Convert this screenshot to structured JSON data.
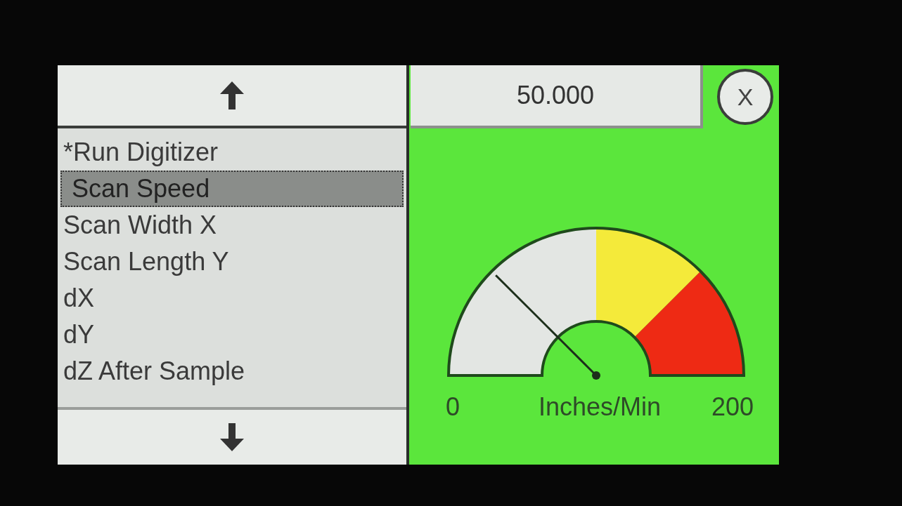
{
  "menu": {
    "items": [
      {
        "label": "*Run Digitizer",
        "selected": false
      },
      {
        "label": "Scan Speed",
        "selected": true
      },
      {
        "label": "Scan Width X",
        "selected": false
      },
      {
        "label": "Scan Length Y",
        "selected": false
      },
      {
        "label": "dX",
        "selected": false
      },
      {
        "label": "dY",
        "selected": false
      },
      {
        "label": "dZ After Sample",
        "selected": false
      }
    ]
  },
  "value_field": {
    "value": "50.000"
  },
  "close_button": {
    "label": "X"
  },
  "gauge": {
    "level": 0.25,
    "zones": [
      {
        "color": "#e3e6e3"
      },
      {
        "color": "#f4ea3a"
      },
      {
        "color": "#ee2a14"
      }
    ],
    "min_label": "0",
    "unit": "Inches/Min",
    "max_label": "200"
  }
}
